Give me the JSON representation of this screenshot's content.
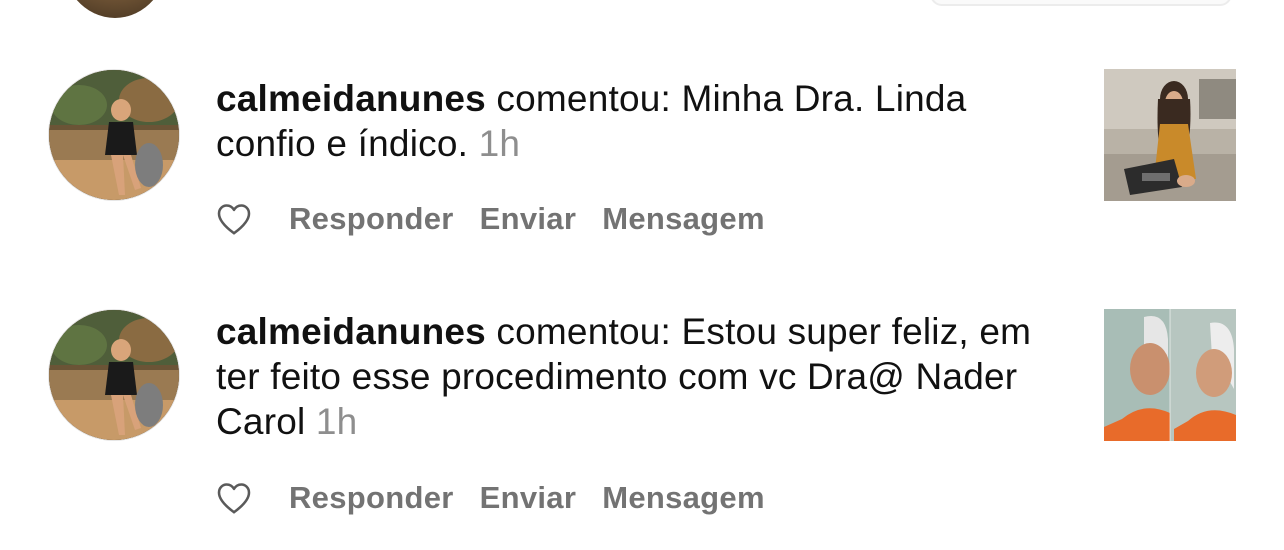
{
  "notifications": [
    {
      "username": "calmeidanunes",
      "verb": "comentou:",
      "comment": "Minha Dra. Linda confio e índico.",
      "time": "1h",
      "actions": {
        "reply": "Responder",
        "send": "Enviar",
        "message": "Mensagem"
      }
    },
    {
      "username": "calmeidanunes",
      "verb": "comentou:",
      "comment": "Estou super feliz, em ter feito esse procedimento com vc Dra@ Nader Carol",
      "time": "1h",
      "actions": {
        "reply": "Responder",
        "send": "Enviar",
        "message": "Mensagem"
      }
    }
  ],
  "icons": {
    "like": "heart-outline-icon"
  },
  "colors": {
    "text": "#111111",
    "secondary": "#8e8e8e",
    "action": "#737373"
  }
}
